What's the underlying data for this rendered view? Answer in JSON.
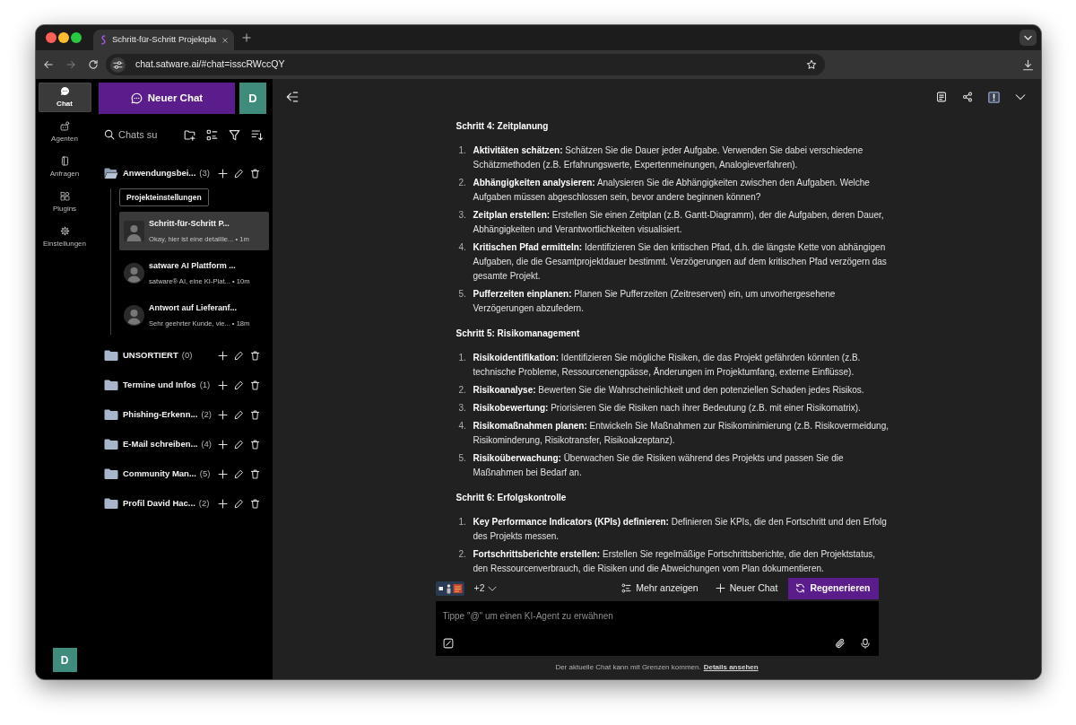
{
  "browser": {
    "tab": {
      "title": "Schritt-für-Schritt Projektpla"
    },
    "url": "chat.satware.ai/#chat=isscRWccQY"
  },
  "rail": {
    "items": [
      {
        "label": "Chat",
        "kind": "chat",
        "selected": true
      },
      {
        "label": "Agenten",
        "kind": "agents",
        "selected": false
      },
      {
        "label": "Anfragen",
        "kind": "requests",
        "selected": false
      },
      {
        "label": "Plugins",
        "kind": "plugins",
        "selected": false
      },
      {
        "label": "Einstellungen",
        "kind": "settings",
        "selected": false
      }
    ],
    "avatar": "D"
  },
  "panel": {
    "new_chat_button": "Neuer Chat",
    "avatar": "D",
    "search": {
      "placeholder": "Chats su"
    },
    "folders": [
      {
        "name": "Anwendungsbei...",
        "count": "(3)",
        "expanded": true,
        "settings_button": "Projekteinstellungen",
        "chats": [
          {
            "title": "Schritt-für-Schritt P...",
            "preview": "Okay, hier ist eine detaillie... • 1m",
            "selected": true
          },
          {
            "title": "satware AI Plattform ...",
            "preview": "satware® AI, eine KI-Plat... • 10m",
            "selected": false
          },
          {
            "title": "Antwort auf Lieferanf...",
            "preview": "Sehr geehrter Kunde, vie... • 18m",
            "selected": false
          }
        ]
      },
      {
        "name": "UNSORTIERT",
        "count": "(0)",
        "expanded": false
      },
      {
        "name": "Termine und Infos",
        "count": "(1)",
        "expanded": false
      },
      {
        "name": "Phishing-Erkenn...",
        "count": "(2)",
        "expanded": false
      },
      {
        "name": "E-Mail schreiben...",
        "count": "(4)",
        "expanded": false
      },
      {
        "name": "Community Man...",
        "count": "(5)",
        "expanded": false
      },
      {
        "name": "Profil David Hac...",
        "count": "(2)",
        "expanded": false
      }
    ]
  },
  "chat": {
    "sections": [
      {
        "heading": "Schritt 4: Zeitplanung",
        "items": [
          {
            "number": "1.",
            "text": "**Aktivitäten schätzen:** Schätzen Sie die Dauer jeder Aufgabe. Verwenden Sie dabei verschiedene Schätzmethoden (z.B. Erfahrungswerte, Expertenmeinungen, Analogieverfahren)."
          },
          {
            "number": "2.",
            "text": "**Abhängigkeiten analysieren:** Analysieren Sie die Abhängigkeiten zwischen den Aufgaben. Welche Aufgaben müssen abgeschlossen sein, bevor andere beginnen können?"
          },
          {
            "number": "3.",
            "text": "**Zeitplan erstellen:** Erstellen Sie einen Zeitplan (z.B. Gantt-Diagramm), der die Aufgaben, deren Dauer, Abhängigkeiten und Verantwortlichkeiten visualisiert."
          },
          {
            "number": "4.",
            "text": "**Kritischen Pfad ermitteln:** Identifizieren Sie den kritischen Pfad, d.h. die längste Kette von abhängigen Aufgaben, die die Gesamtprojektdauer bestimmt. Verzögerungen auf dem kritischen Pfad verzögern das gesamte Projekt."
          },
          {
            "number": "5.",
            "text": "**Pufferzeiten einplanen:** Planen Sie Pufferzeiten (Zeitreserven) ein, um unvorhergesehene Verzögerungen abzufedern."
          }
        ]
      },
      {
        "heading": "Schritt 5: Risikomanagement",
        "items": [
          {
            "number": "1.",
            "text": "**Risikoidentifikation:** Identifizieren Sie mögliche Risiken, die das Projekt gefährden könnten (z.B. technische Probleme, Ressourcenengpässe, Änderungen im Projektumfang, externe Einflüsse)."
          },
          {
            "number": "2.",
            "text": "**Risikoanalyse:** Bewerten Sie die Wahrscheinlichkeit und den potenziellen Schaden jedes Risikos."
          },
          {
            "number": "3.",
            "text": "**Risikobewertung:** Priorisieren Sie die Risiken nach ihrer Bedeutung (z.B. mit einer Risikomatrix)."
          },
          {
            "number": "4.",
            "text": "**Risikomaßnahmen planen:** Entwickeln Sie Maßnahmen zur Risikominimierung (z.B. Risikovermeidung, Risikominderung, Risikotransfer, Risikoakzeptanz)."
          },
          {
            "number": "5.",
            "text": "**Risikoüberwachung:** Überwachen Sie die Risiken während des Projekts und passen Sie die Maßnahmen bei Bedarf an."
          }
        ]
      },
      {
        "heading": "Schritt 6: Erfolgskontrolle",
        "items": [
          {
            "number": "1.",
            "text": "**Key Performance Indicators (KPIs) definieren:** Definieren Sie KPIs, die den Fortschritt und den Erfolg des Projekts messen."
          },
          {
            "number": "2.",
            "text": "**Fortschrittsberichte erstellen:** Erstellen Sie regelmäßige Fortschrittsberichte, die den Projektstatus, den Ressourcenverbrauch, die Risiken und die Abweichungen vom Plan dokumentieren."
          }
        ]
      }
    ]
  },
  "toolbar": {
    "model_overflow": "+2",
    "actions": [
      {
        "label": "Mehr anzeigen",
        "kind": "list"
      },
      {
        "label": "Neuer Chat",
        "kind": "new"
      },
      {
        "label": "Regenerieren",
        "kind": "regenerate"
      }
    ]
  },
  "composer": {
    "placeholder": "Tippe \"@\" um einen KI-Agent zu erwähnen"
  },
  "footer": {
    "notice": "Der aktuelle Chat kann mit Grenzen kommen.",
    "link": "Details ansehen"
  }
}
